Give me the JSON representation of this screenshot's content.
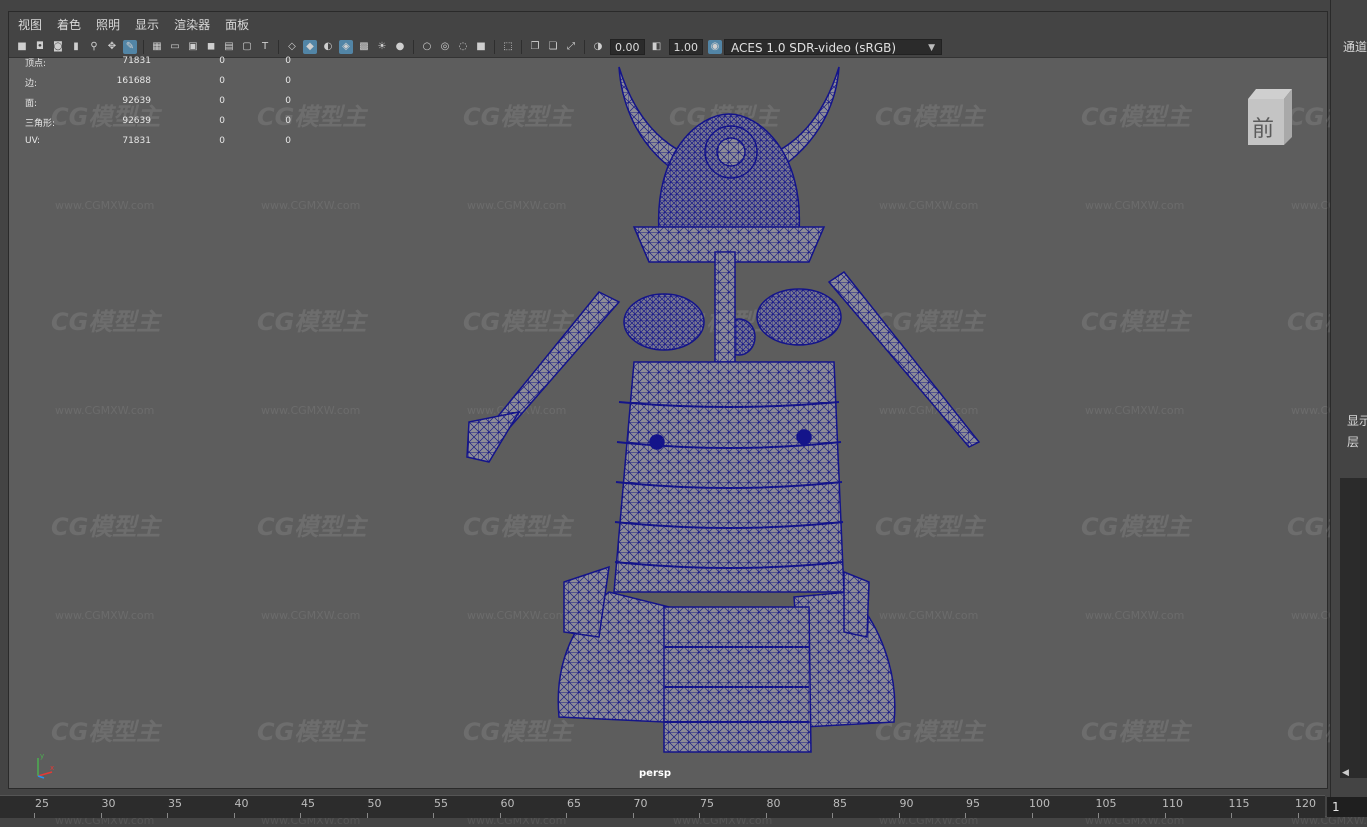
{
  "menu": {
    "view": "视图",
    "shading": "着色",
    "lighting": "照明",
    "show": "显示",
    "renderer": "渲染器",
    "panels": "面板"
  },
  "toolbar": {
    "exposure_value": "0.00",
    "gamma_value": "1.00",
    "color_space": "ACES 1.0 SDR-video (sRGB)",
    "icons": [
      "camera-icon",
      "camera-attr-icon",
      "bookmark-icon",
      "image-plane-icon",
      "grid-icon",
      "film-gate-icon",
      "resolution-gate-icon",
      "gate-mask-icon",
      "field-chart-icon",
      "safe-action-icon",
      "safe-title-icon",
      "wireframe-icon",
      "smooth-shade-icon",
      "default-material-icon",
      "wireframe-on-shaded-icon",
      "xray-icon",
      "use-all-lights-icon",
      "shadows-icon",
      "ambient-occlusion-icon",
      "motion-blur-icon",
      "antialias-icon",
      "depth-of-field-icon",
      "isolate-icon",
      "select-camera-icon"
    ]
  },
  "hud": {
    "rows": [
      {
        "label": "顶点:",
        "v1": "71831",
        "v2": "0",
        "v3": "0"
      },
      {
        "label": "边:",
        "v1": "161688",
        "v2": "0",
        "v3": "0"
      },
      {
        "label": "面:",
        "v1": "92639",
        "v2": "0",
        "v3": "0"
      },
      {
        "label": "三角形:",
        "v1": "92639",
        "v2": "0",
        "v3": "0"
      },
      {
        "label": "UV:",
        "v1": "71831",
        "v2": "0",
        "v3": "0"
      }
    ]
  },
  "watermark": {
    "logo": "CG模型主",
    "url": "www.CGMXW.com"
  },
  "view_cube": {
    "face": "前"
  },
  "camera": {
    "name": "persp"
  },
  "right_panel": {
    "channel_title": "通道",
    "display_tab": "显示",
    "layer_tab": "层"
  },
  "timeline": {
    "ticks": [
      "25",
      "30",
      "35",
      "40",
      "45",
      "50",
      "55",
      "60",
      "65",
      "70",
      "75",
      "80",
      "85",
      "90",
      "95",
      "100",
      "105",
      "110",
      "115",
      "120"
    ],
    "current_frame": "1"
  },
  "colors": {
    "viewport_bg": "#5d5d5d",
    "wireframe": "#14148a",
    "accent": "#5285a6"
  }
}
